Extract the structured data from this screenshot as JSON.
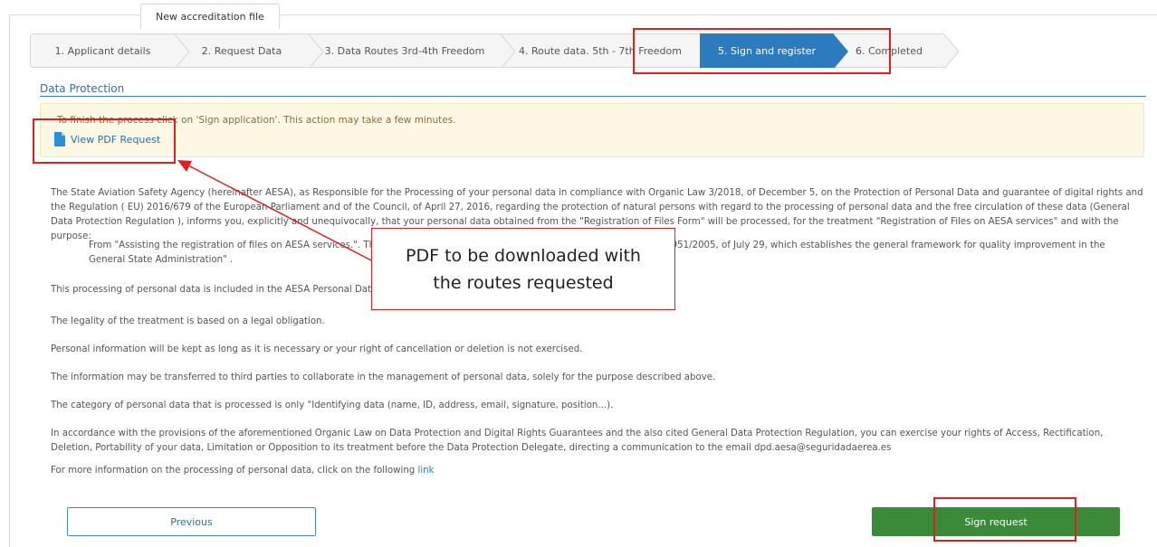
{
  "file_tab": {
    "label": "New accreditation file"
  },
  "wizard": {
    "steps": [
      {
        "label": "1. Applicant details"
      },
      {
        "label": "2. Request Data"
      },
      {
        "label": "3. Data Routes 3rd-4th Freedom"
      },
      {
        "label": "4. Route data. 5th - 7th Freedom"
      },
      {
        "label": "5. Sign and register"
      },
      {
        "label": "6. Completed"
      }
    ],
    "active_index": 4
  },
  "section": {
    "title": "Data Protection"
  },
  "alert": {
    "text": "To finish the process click on 'Sign application'. This action may take a few minutes.",
    "pdf_link": "View PDF Request"
  },
  "content": {
    "intro": "The State Aviation Safety Agency (hereinafter AESA), as Responsible for the Processing of your personal data in compliance with Organic Law 3/2018, of December 5, on the Protection of Personal Data and guarantee of digital rights and the Regulation ( EU) 2016/679 of the European Parliament and of the Council, of April 27, 2016, regarding the protection of natural persons with regard to the processing of personal data and the free circulation of these data (General Data Protection Regulation ), informs you, explicitly and unequivocally, that your personal data obtained from the \"Registration of Files Form\" will be processed, for the treatment \"Registration of Files on AESA services\" and with the purpose:",
    "quote": "From \"Assisting the registration of files on AESA services.\". The purpose of the treatment is the one defined by \"Royal Decree 951/2005, of July 29, which establishes the general framework for quality improvement in the General State Administration\" .",
    "p1": "This processing of personal data is included in the AESA Personal Data Processing Activities Register.",
    "p2": "The legality of the treatment is based on a legal obligation.",
    "p3": "Personal information will be kept as long as it is necessary or your right of cancellation or deletion is not exercised.",
    "p4": "The information may be transferred to third parties to collaborate in the management of personal data, solely for the purpose described above.",
    "p5": "The category of personal data that is processed is only \"Identifying data (name, ID, address, email, signature, position...).",
    "p6": "In accordance with the provisions of the aforementioned Organic Law on Data Protection and Digital Rights Guarantees and the also cited General Data Protection Regulation, you can exercise your rights of Access, Rectification, Deletion, Portability of your data, Limitation or Opposition to its treatment before the Data Protection Delegate, directing a communication to the email dpd.aesa@seguridadaerea.es",
    "p7_prefix": "For more information on the processing of personal data, click on the following ",
    "p7_link": "link"
  },
  "buttons": {
    "previous": "Previous",
    "sign": "Sign request"
  },
  "annotation": {
    "line1": "PDF to be downloaded with",
    "line2": "the routes requested"
  },
  "colors": {
    "active_step": "#2c7bbf",
    "sign_button": "#3a8a3a",
    "highlight": "#e02020",
    "alert_bg": "#fcf8e3"
  },
  "icons": {
    "pdf": "file-icon"
  }
}
